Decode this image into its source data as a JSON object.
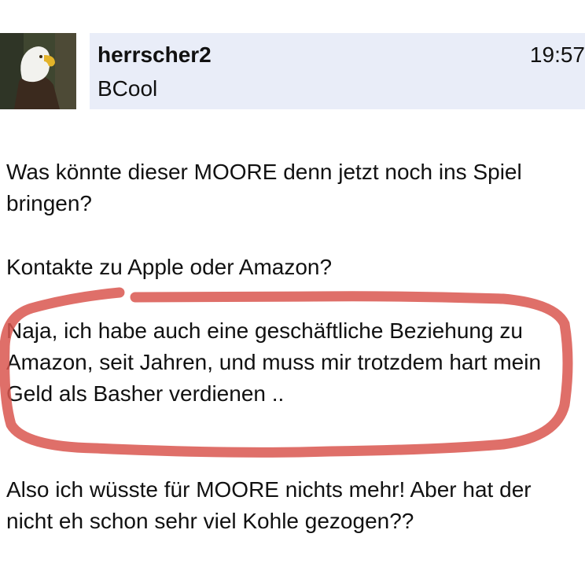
{
  "post": {
    "username": "herrscher2",
    "rank": "BCool",
    "time": "19:57",
    "avatar_icon": "eagle-avatar"
  },
  "body": {
    "p1": "Was könnte dieser MOORE denn jetzt noch ins Spiel bringen?",
    "p2": "Kontakte zu Apple oder Amazon?",
    "p3": "Naja, ich habe auch eine geschäftliche Beziehung zu Amazon, seit Jahren, und muss mir trotzdem hart mein Geld als Basher verdienen ..",
    "p4": "Also ich wüsste für MOORE nichts mehr! Aber hat der nicht eh schon sehr viel Kohle gezogen??"
  },
  "annotation": {
    "color": "#d9564f"
  }
}
